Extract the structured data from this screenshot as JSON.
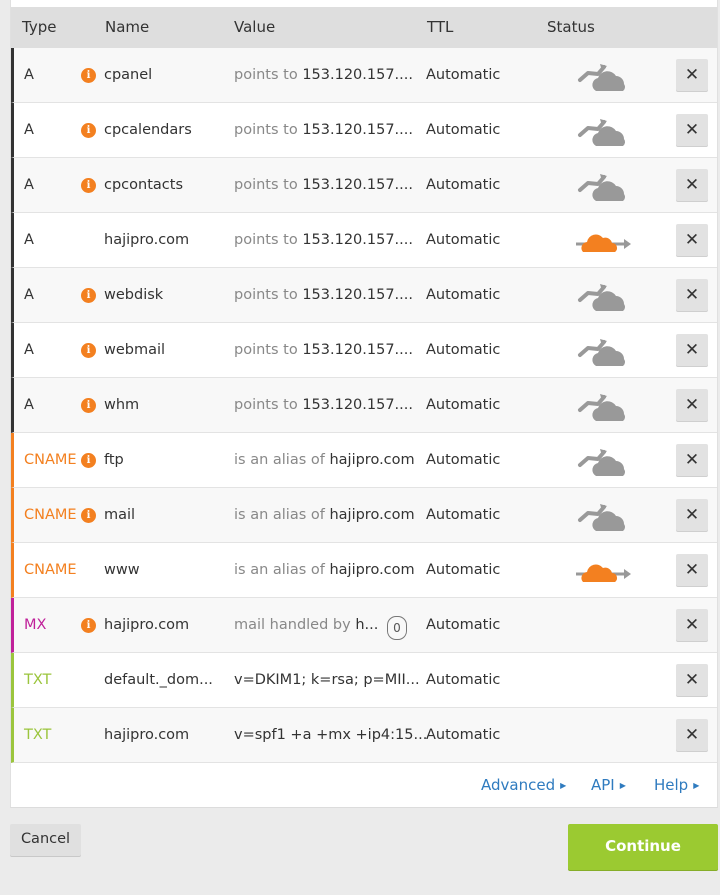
{
  "table": {
    "headers": {
      "type": "Type",
      "name": "Name",
      "value": "Value",
      "ttl": "TTL",
      "status": "Status"
    },
    "type_colors": {
      "A": "#333333",
      "CNAME": "#f38020",
      "MX": "#c0219a",
      "TXT": "#9bc53d"
    },
    "rows": [
      {
        "type": "A",
        "warning": true,
        "name": "cpanel",
        "value_prefix": "points to ",
        "value": "153.120.157....",
        "ttl": "Automatic",
        "status": "dns-only",
        "priority": null
      },
      {
        "type": "A",
        "warning": true,
        "name": "cpcalendars",
        "value_prefix": "points to ",
        "value": "153.120.157....",
        "ttl": "Automatic",
        "status": "dns-only",
        "priority": null
      },
      {
        "type": "A",
        "warning": true,
        "name": "cpcontacts",
        "value_prefix": "points to ",
        "value": "153.120.157....",
        "ttl": "Automatic",
        "status": "dns-only",
        "priority": null
      },
      {
        "type": "A",
        "warning": false,
        "name": "hajipro.com",
        "value_prefix": "points to ",
        "value": "153.120.157....",
        "ttl": "Automatic",
        "status": "proxied",
        "priority": null
      },
      {
        "type": "A",
        "warning": true,
        "name": "webdisk",
        "value_prefix": "points to ",
        "value": "153.120.157....",
        "ttl": "Automatic",
        "status": "dns-only",
        "priority": null
      },
      {
        "type": "A",
        "warning": true,
        "name": "webmail",
        "value_prefix": "points to ",
        "value": "153.120.157....",
        "ttl": "Automatic",
        "status": "dns-only",
        "priority": null
      },
      {
        "type": "A",
        "warning": true,
        "name": "whm",
        "value_prefix": "points to ",
        "value": "153.120.157....",
        "ttl": "Automatic",
        "status": "dns-only",
        "priority": null
      },
      {
        "type": "CNAME",
        "warning": true,
        "name": "ftp",
        "value_prefix": "is an alias of ",
        "value": "hajipro.com",
        "ttl": "Automatic",
        "status": "dns-only",
        "priority": null
      },
      {
        "type": "CNAME",
        "warning": true,
        "name": "mail",
        "value_prefix": "is an alias of ",
        "value": "hajipro.com",
        "ttl": "Automatic",
        "status": "dns-only",
        "priority": null
      },
      {
        "type": "CNAME",
        "warning": false,
        "name": "www",
        "value_prefix": "is an alias of ",
        "value": "hajipro.com",
        "ttl": "Automatic",
        "status": "proxied",
        "priority": null
      },
      {
        "type": "MX",
        "warning": true,
        "name": "hajipro.com",
        "value_prefix": "mail handled by ",
        "value": "h...",
        "ttl": "Automatic",
        "status": "none",
        "priority": "0"
      },
      {
        "type": "TXT",
        "warning": false,
        "name": "default._dom...",
        "value_prefix": "",
        "value": "v=DKIM1; k=rsa; p=MII...",
        "ttl": "Automatic",
        "status": "none",
        "priority": null
      },
      {
        "type": "TXT",
        "warning": false,
        "name": "hajipro.com",
        "value_prefix": "",
        "value": "v=spf1 +a +mx +ip4:15...",
        "ttl": "Automatic",
        "status": "none",
        "priority": null
      }
    ],
    "info_icon": "info-icon",
    "delete_icon": "close-icon",
    "delete_glyph": "✕"
  },
  "footer_links": [
    {
      "label": "Advanced"
    },
    {
      "label": "API"
    },
    {
      "label": "Help"
    }
  ],
  "buttons": {
    "cancel": "Cancel",
    "continue": "Continue"
  },
  "colors": {
    "proxied_cloud": "#f38020",
    "dns_only_cloud": "#999999",
    "continue_bg": "#9bca31",
    "link": "#2f7bbf"
  }
}
